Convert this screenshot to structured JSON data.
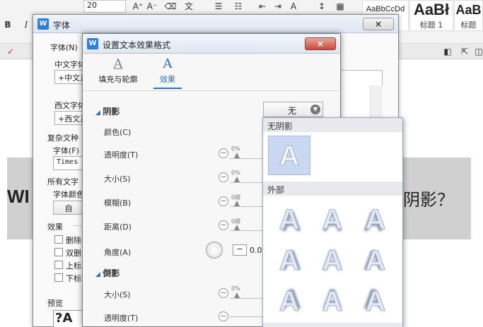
{
  "ribbon": {
    "font_size": "20",
    "bold": "B",
    "italic": "I",
    "styles": [
      {
        "preview": "AaBbCcDd",
        "label": ""
      },
      {
        "preview": "AaBł",
        "label": "标题 1"
      },
      {
        "preview": "AaB",
        "label": "标题"
      }
    ]
  },
  "document": {
    "left_text": "WI",
    "right_text": "阴影？"
  },
  "font_dialog": {
    "title": "字体",
    "close": "×",
    "tab_font": "字体(N)",
    "chinese_font_label": "中文字体",
    "chinese_font_value": "+中文正",
    "western_font_label": "西文字体",
    "western_font_value": "+西文正",
    "complex_label": "复杂文种",
    "complex_font_label": "字体(F)",
    "complex_font_value": "Times",
    "all_text_label": "所有文字",
    "font_color_label": "字体颜色",
    "font_color_value": "自",
    "effects_label": "效果",
    "effects": [
      "删除",
      "双删",
      "上标",
      "下标"
    ],
    "preview_label": "预览",
    "preview_text": "?A ?"
  },
  "effects_dialog": {
    "title": "设置文本效果格式",
    "close": "×",
    "tabs": [
      {
        "icon": "A",
        "label": "填充与轮廓"
      },
      {
        "icon": "A",
        "label": "效果"
      }
    ],
    "shadow_section": "阴影",
    "shadow_value": "无",
    "color_label": "颜色(C)",
    "transparency_label": "透明度(T)",
    "size_label": "大小(S)",
    "blur_label": "模糊(B)",
    "distance_label": "距离(D)",
    "angle_label": "角度(A)",
    "angle_value": "0.0",
    "pct_value": "0%",
    "pt_value": "0磅",
    "reflection_section": "倒影",
    "refl_size_label": "大小(S)",
    "refl_transparency_label": "透明度(T)"
  },
  "shadow_dropdown": {
    "no_shadow_header": "无阴影",
    "outer_header": "外部",
    "glyph": "A"
  },
  "colors": {
    "accent": "#2f6fbf",
    "close_red": "#c9493a",
    "selected_cell": "#c9d8f0"
  }
}
